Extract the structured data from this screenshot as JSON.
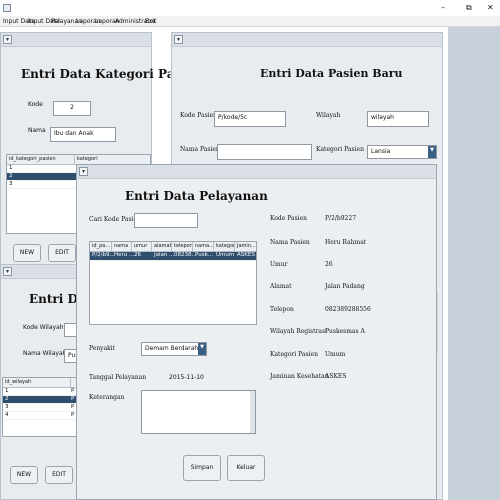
{
  "window": {
    "minimize": "–",
    "maximize": "⧉",
    "close": "✕"
  },
  "menu": [
    "Input Data",
    "Input Data",
    "Pelayanan",
    "Laporan",
    "Laporan",
    "Administrator",
    "Exit"
  ],
  "kategori": {
    "title": "Entri Data Kategori Pasien",
    "kode_label": "Kode",
    "kode_value": "2",
    "nama_label": "Nama",
    "nama_value": "Ibu dan Anak",
    "columns": [
      "id_kategori_pasien",
      "kategori"
    ],
    "rows": [
      "1",
      "2",
      "3"
    ],
    "selected_row": 1,
    "new_btn": "NEW",
    "edit_btn": "EDIT"
  },
  "wilayah": {
    "title": "Entri Data W",
    "kode_label": "Kode Wilayah",
    "kode_value": "",
    "nama_label": "Nama Wilayah",
    "nama_value": "Pusk",
    "columns": [
      "id_wilayah"
    ],
    "rows": [
      {
        "id": "1",
        "c": "P"
      },
      {
        "id": "2",
        "c": "P"
      },
      {
        "id": "3",
        "c": "P"
      },
      {
        "id": "4",
        "c": "P"
      }
    ],
    "selected_row": 1,
    "new_btn": "NEW",
    "edit_btn": "EDIT"
  },
  "pasien_baru": {
    "title": "Entri Data Pasien Baru",
    "kode_label": "Kode Pasien",
    "kode_value": "P/kode/5c",
    "wilayah_label": "Wilayah",
    "wilayah_value": "wilayah",
    "nama_label": "Nama Pasien",
    "nama_value": "",
    "kategori_label": "Kategori Pasien",
    "kategori_value": "Lansia"
  },
  "pelayanan": {
    "title": "Entri Data Pelayanan",
    "cari_label": "Cari Kode Pasien :",
    "cari_value": "",
    "columns": [
      "id_pa...",
      "nama",
      "umur",
      "alamat",
      "telepon",
      "nama...",
      "kategori",
      "Jamin..."
    ],
    "row": [
      "P/2/b9...",
      "Heru ...",
      "26",
      "Jalan ...",
      "08238...",
      "Pusk...",
      "Umum",
      "ASKES"
    ],
    "penyakit_label": "Penyakit",
    "penyakit_value": "Demam Berdarah",
    "tanggal_label": "Tanggal Pelayanan",
    "tanggal_value": "2015-11-10",
    "keterangan_label": "Keterangan",
    "simpan_btn": "Simpan",
    "keluar_btn": "Keluar",
    "detail": [
      {
        "label": "Kode Pasien",
        "value": "P/2/b9227"
      },
      {
        "label": "Nama Pasien",
        "value": "Heru Rahmat"
      },
      {
        "label": "Umur",
        "value": "26"
      },
      {
        "label": "Alamat",
        "value": "Jalan Padang"
      },
      {
        "label": "Telepon",
        "value": "082389288556"
      },
      {
        "label": "Wilayah Registrasi",
        "value": "Puskesmas A"
      },
      {
        "label": "Kategori Pasien",
        "value": "Umum"
      },
      {
        "label": "Jaminan Kesehatan",
        "value": "ASKES"
      }
    ]
  }
}
